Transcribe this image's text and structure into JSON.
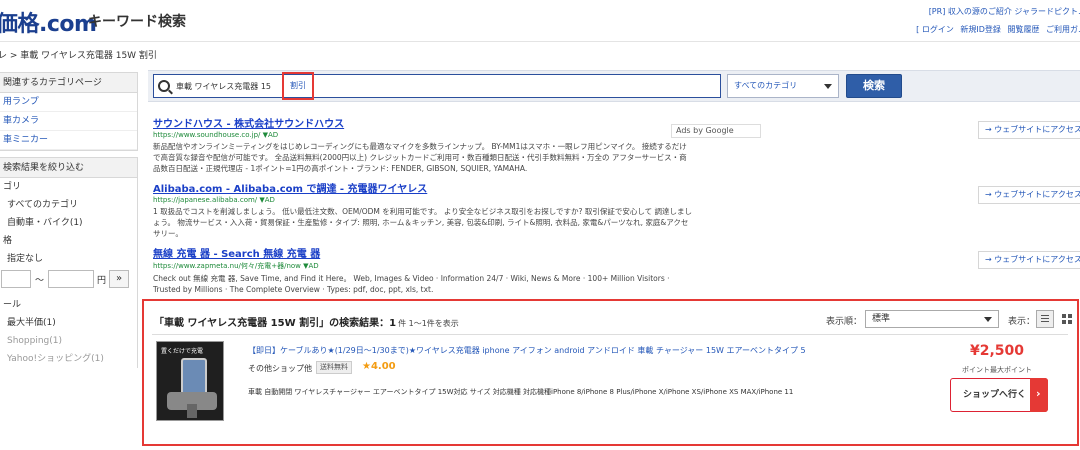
{
  "header": {
    "logo_prefix": "価格",
    "logo_suffix": ".com",
    "subtitle": "キーワード検索",
    "top_links": "[PR] 収入の源のご紹介 ジャラードピクト…",
    "user_links": [
      "[ ログイン",
      "新規ID登録",
      "閲覧履歴",
      "ご利用ガ…"
    ]
  },
  "breadcrumb": "レ > 車載 ワイヤレス充電器 15W 割引",
  "sidebar": {
    "related_header": "関連するカテゴリページ",
    "related_items": [
      "用ランプ",
      "車カメラ",
      "車ミニカー"
    ],
    "filter_header": "検索結果を絞り込む",
    "category_label": "ゴリ",
    "category_all": "すべてのカテゴリ",
    "category_sub": "自動車・バイク(1)",
    "price_label": "格",
    "price_none": "指定なし",
    "price_tilde": "〜",
    "price_yen": "円",
    "price_go": "»",
    "shop_label": "ール",
    "shop_items": [
      "最大半価(1)",
      "Shopping(1)",
      "Yahoo!ショッピング(1)"
    ]
  },
  "search": {
    "query": "車載 ワイヤレス充電器 15",
    "highlight_text": "割引",
    "category_selected": "すべてのカテゴリ",
    "button_label": "検索"
  },
  "ads": {
    "ads_by": "Ads by Google",
    "visit_label": "→ ウェブサイトにアクセス",
    "items": [
      {
        "title": "サウンドハウス - 株式会社サウンドハウス",
        "url": "https://www.soundhouse.co.jp/ ▼AD",
        "desc": "新品配信やオンラインミーティングをはじめレコーディングにも最適なマイクを多数ラインナップ。 BY-MM1はスマホ・一眼レフ用ピンマイク。 接続するだけで高音質な録音や配信が可能です。 全品送料無料(2000円以上) クレジットカードご利用可・数百種類日配送・代引手数料無料・万全の アフターサービス・商品数百日配送・正規代理店 - 1ポイント=1円の高ポイント・ブランド: FENDER, GIBSON, SQUIER, YAMAHA."
      },
      {
        "title": "Alibaba.com - Alibaba.com で調達 - 充電器ワイヤレス",
        "url": "https://japanese.alibaba.com/ ▼AD",
        "desc": "1 取扱品でコストを削減しましょう。 低い最低注文数、OEM/ODM を利用可能です。 より安全なビジネス取引をお探しですか? 取引保証で安心して 調達しましょう。 物流サービス・入入荷・貿易保証・生産監修・タイプ: 照明, ホーム＆キッチン, 美容, 包装&印刷, ライト&照明, 衣料品, 家電&パーツなれ, 家庭&アクセサリー。"
      },
      {
        "title": "無線 充電 器 - Search 無線 充電 器",
        "url": "https://www.zapmeta.nu/何々/充電+器/now ▼AD",
        "desc": "Check out 無線 充電 器, Save Time, and Find it Here。 Web, Images & Video · Information 24/7 · Wiki, News & More · 100+ Million Visitors · Trusted by Millions · The Complete Overview · Types: pdf, doc, ppt, xls, txt."
      }
    ]
  },
  "results": {
    "title": "「車載 ワイヤレス充電器 15W 割引」の検索結果：1",
    "count": "件 1〜1件を表示",
    "sort_label": "表示順：",
    "sort_selected": "標準",
    "display_label": "表示：",
    "product": {
      "thumb_text": "置くだけで充電",
      "title": "【即日】ケーブルあり★(1/29日〜1/30まで)★ワイヤレス充電器 iphone アイフォン android アンドロイド 車載 チャージャー 15W エアーベントタイプ 5",
      "shop": "その他ショップ他",
      "badge": "送料無料",
      "rating": "★4.00",
      "desc": "車載 自動開閉 ワイヤレスチャージャー エアーベントタイプ 15W対応 サイズ 対応機種 対応機種iPhone 8/iPhone 8 Plus/iPhone X/iPhone XS/iPhone XS MAX/iPhone 11",
      "price": "¥2,500",
      "points": "ポイント最大ポイント",
      "shop_button": "ショップへ行く"
    }
  }
}
